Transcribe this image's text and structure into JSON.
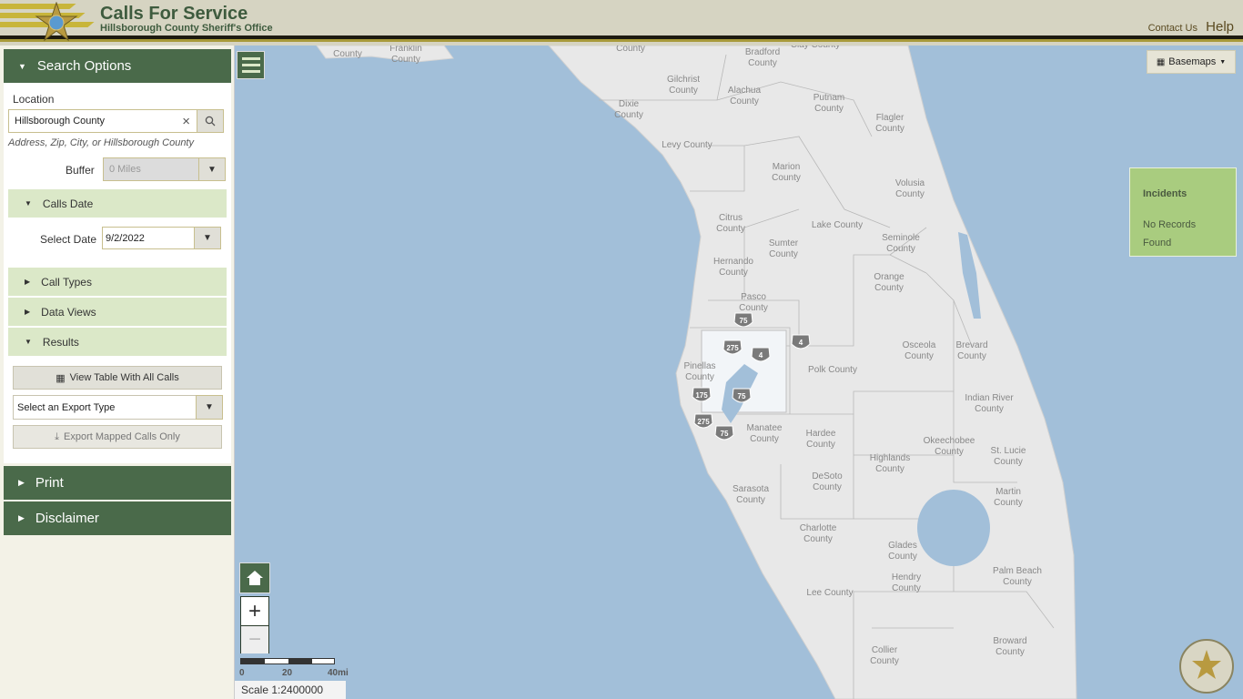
{
  "header": {
    "title": "Calls For Service",
    "subtitle": "Hillsborough County Sheriff's Office",
    "contact": "Contact Us",
    "help": "Help"
  },
  "sidebar": {
    "search_options": "Search Options",
    "location_label": "Location",
    "location_value": "Hillsborough County",
    "location_hint": "Address, Zip, City, or Hillsborough County",
    "buffer_label": "Buffer",
    "buffer_value": "0 Miles",
    "calls_date": "Calls Date",
    "select_date_label": "Select Date",
    "select_date_value": "9/2/2022",
    "call_types": "Call Types",
    "data_views": "Data Views",
    "results": "Results",
    "view_table": "View Table With All Calls",
    "export_type": "Select an Export Type",
    "export_mapped": "Export Mapped Calls Only",
    "print": "Print",
    "disclaimer": "Disclaimer"
  },
  "map": {
    "basemaps": "Basemaps",
    "incidents_title": "Incidents",
    "incidents_status": "No Records Found",
    "scale_ticks": [
      "0",
      "20",
      "40mi"
    ],
    "scale": "Scale 1:2400000",
    "counties": [
      "County",
      "Franklin County",
      "County",
      "Bradford County",
      "Clay County",
      "Gilchrist County",
      "Alachua County",
      "Putnam County",
      "Dixie County",
      "Flagler County",
      "Levy County",
      "Marion County",
      "Volusia County",
      "Citrus County",
      "Lake County",
      "Sumter County",
      "Seminole County",
      "Hernando County",
      "Orange County",
      "Pasco County",
      "Osceola County",
      "Brevard County",
      "Pinellas County",
      "Polk County",
      "Indian River County",
      "Manatee County",
      "Hardee County",
      "Okeechobee County",
      "St. Lucie County",
      "Highlands County",
      "DeSoto County",
      "Sarasota County",
      "Martin County",
      "Charlotte County",
      "Glades County",
      "Hendry County",
      "Palm Beach County",
      "Lee County",
      "Collier County",
      "Broward County"
    ],
    "interstates": [
      "75",
      "275",
      "4",
      "4",
      "175",
      "75",
      "275",
      "75"
    ]
  },
  "colors": {
    "brand_green": "#4a6a4a",
    "light_green": "#dbe8c8",
    "water": "#a2bfd9",
    "land": "#e8e8e8",
    "incidents_bg": "#a9cc7f"
  }
}
